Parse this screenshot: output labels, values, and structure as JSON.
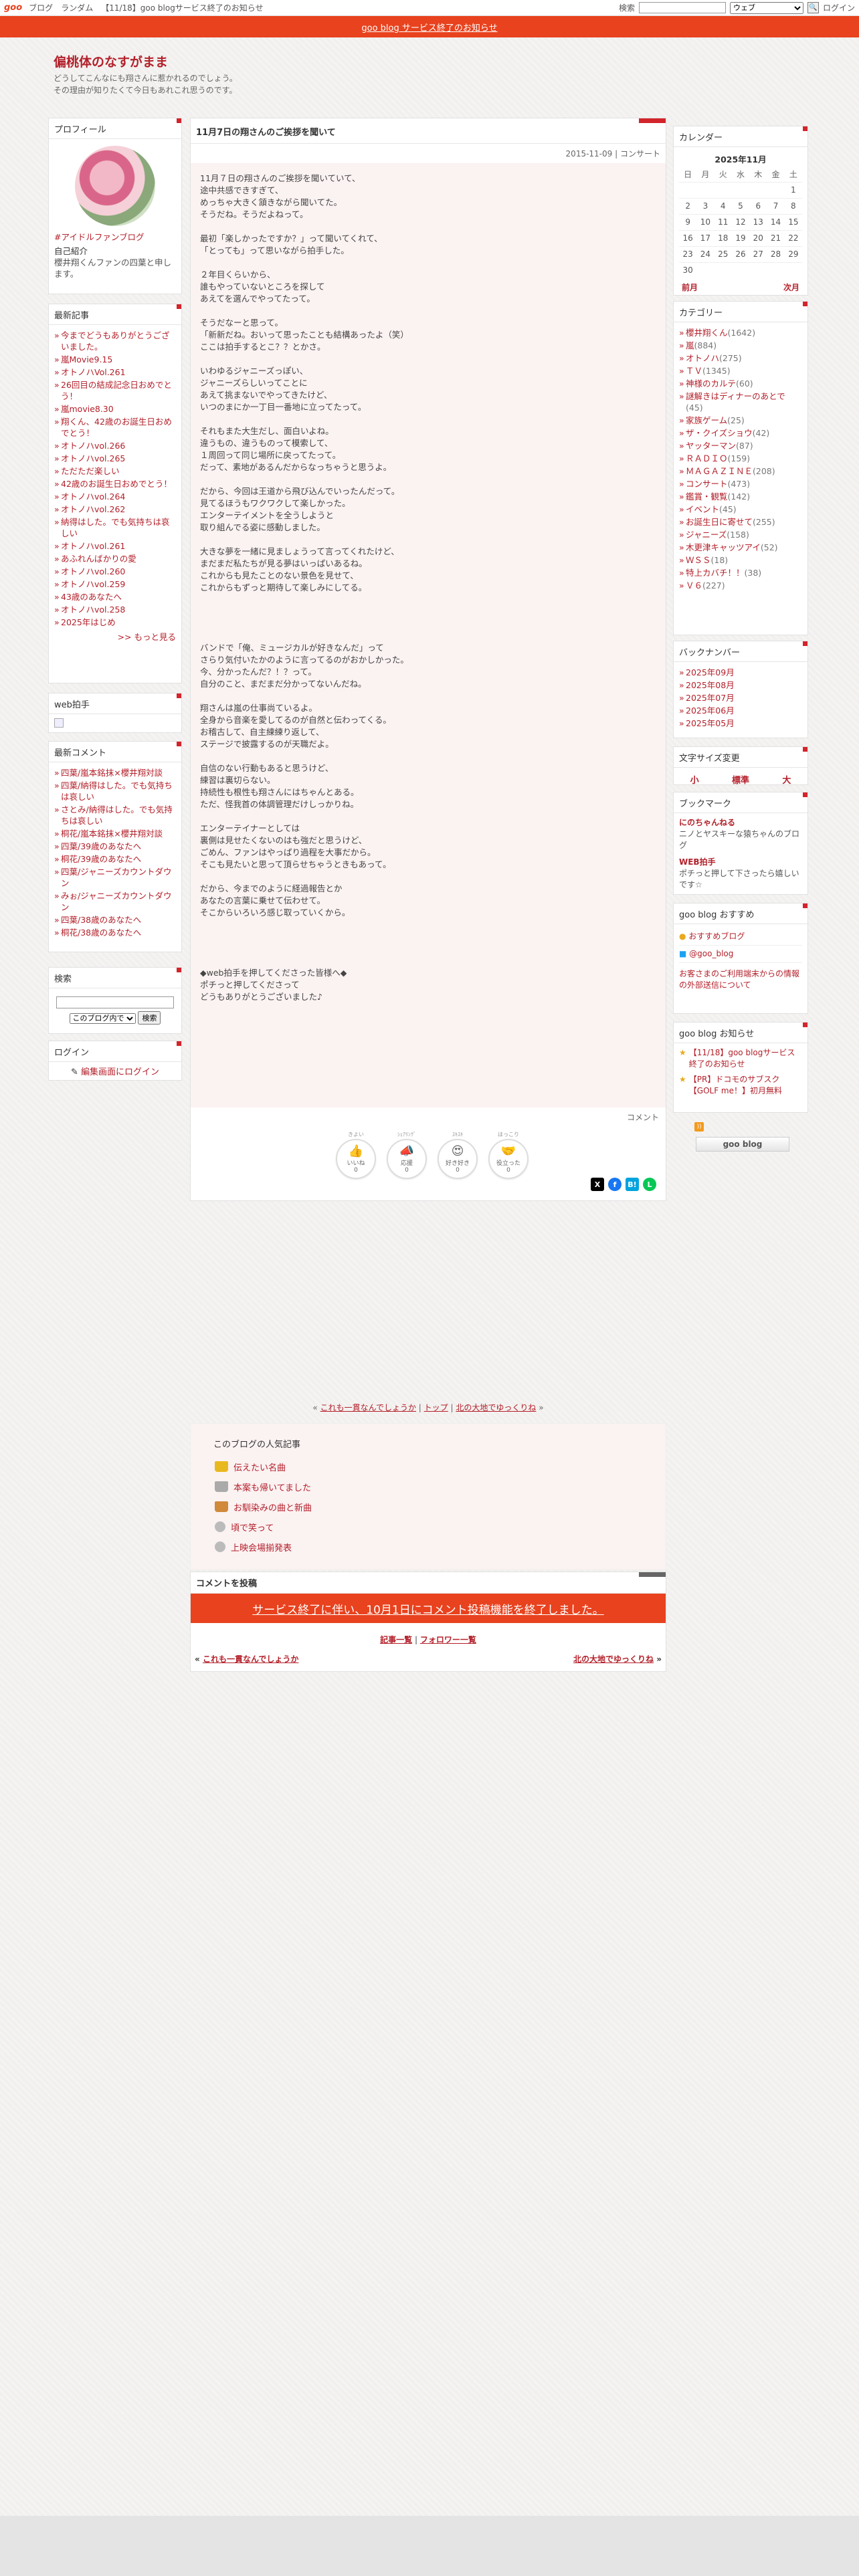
{
  "topbar": {
    "logo": "goo",
    "links": [
      "ブログ",
      "ランダム",
      "【11/18】goo blogサービス終了のお知らせ"
    ],
    "search_label": "検索",
    "search_scope": "ウェブ",
    "login": "ログイン"
  },
  "notice": "goo blog サービス終了のお知らせ",
  "blog": {
    "title": "偏桃体のなすがまま",
    "desc_line1": "どうしてこんなにも翔さんに惹かれるのでしょう。",
    "desc_line2": "その理由が知りたくて今日もあれこれ思うのです。"
  },
  "profile": {
    "title": "プロフィール",
    "link": "#アイドルファンブログ",
    "intro_label": "自己紹介",
    "intro": "櫻井翔くんファンの四葉と申します。"
  },
  "recent_posts": {
    "title": "最新記事",
    "items": [
      "今までどうもありがとうございました。",
      "嵐Movie9.15",
      "オトノハVol.261",
      "26回目の結成記念日おめでとう！",
      "嵐movie8.30",
      "翔くん、42歳のお誕生日おめでとう！",
      "オトノハvol.266",
      "オトノハvol.265",
      "ただただ楽しい",
      "42歳のお誕生日おめでとう！",
      "オトノハvol.264",
      "オトノハvol.262",
      "納得はした。でも気持ちは哀しい",
      "オトノハvol.261",
      "あふれんばかりの愛",
      "オトノハvol.260",
      "オトノハvol.259",
      "43歳のあなたへ",
      "オトノハvol.258",
      "2025年はじめ"
    ],
    "more": ">> もっと見る"
  },
  "web_clap": {
    "title": "web拍手"
  },
  "recent_comments": {
    "title": "最新コメント",
    "items": [
      "四葉/嵐本銘抹×櫻井翔対談",
      "四葉/納得はした。でも気持ちは哀しい",
      "さとみ/納得はした。でも気持ちは哀しい",
      "桐花/嵐本銘抹×櫻井翔対談",
      "四葉/39歳のあなたへ",
      "桐花/39歳のあなたへ",
      "四葉/ジャニーズカウントダウン",
      "みぉ/ジャニーズカウントダウン",
      "四葉/38歳のあなたへ",
      "桐花/38歳のあなたへ"
    ]
  },
  "search_box": {
    "title": "検索",
    "scope": "このブログ内で",
    "button": "検索"
  },
  "login_box": {
    "title": "ログイン",
    "link": "編集画面にログイン"
  },
  "entry": {
    "title": "11月7日の翔さんのご挨拶を聞いて",
    "date": "2015-11-09",
    "category": "コンサート",
    "paragraphs": [
      "11月７日の翔さんのご挨拶を聞いていて、\n途中共感できすぎて、\nめっちゃ大きく頷きながら聞いてた。\nそうだね。そうだよねって。",
      "最初「楽しかったですか？」って聞いてくれて、\n「とっても」って思いながら拍手した。",
      "２年目くらいから、\n誰もやっていないところを探して\nあえてを選んでやってたって。",
      "そうだなーと思って。\n「新新だね。おいって思ったことも結構あったよ（笑）\nここは拍手するとこ？？とかさ。",
      "いわゆるジャニーズっぽい、\nジャニーズらしいってことに\nあえて挑まないでやってきたけど、\nいつのまにか一丁目一番地に立ってたって。",
      "それもまた大生だし、面白いよね。\n違うもの、違うものって模索して、\n１周回って同じ場所に戻ってたって。\nだって、素地があるんだからなっちゃうと思うよ。",
      "だから、今回は王道から飛び込んでいったんだって。\n見てるほうもワクワクして楽しかった。\nエンターテイメントを全うしようと\n取り組んでる姿に感動しました。",
      "大きな夢を一緒に見ましょうって言ってくれたけど、\nまだまだ私たちが見る夢はいっぱいあるね。\nこれからも見たことのない景色を見せて、\nこれからもずっと期待して楽しみにしてる。",
      "",
      "バンドで「俺、ミュージカルが好きなんだ」って\nさらり気付いたかのように言ってるのがおかしかった。\n今、分かったんだ？！？って。\n自分のこと、まだまだ分かってないんだね。",
      "翔さんは嵐の仕事尚ているよ。\n全身から音楽を愛してるのが自然と伝わってくる。\nお稽古して、自主練練り返して、\nステージで披露するのが天職だよ。",
      "自信のない行動もあると思うけど、\n練習は裏切らない。\n持続性も根性も翔さんにはちゃんとある。\nただ、怪我首の体調管理だけしっかりね。",
      "エンターテイナーとしては\n裏側は見せたくないのはも強だと思うけど、\nごめん、ファンはやっぱり過程を大事だから。\nそこも見たいと思って頂らせちゃうときもあって。",
      "だから、今までのように経過報告とか\nあなたの言葉に乗せて伝わせて。\nそこからいろいろ感じ取っていくから。",
      "",
      "◆web拍手を押してくださった皆様へ◆\nポチっと押してくださって\nどうもありがとうございました♪"
    ],
    "comment_label": "コメント"
  },
  "reactions": [
    {
      "top": "きよい",
      "label": "いいね",
      "count": "0"
    },
    {
      "top": "ｼｪｱﾘﾝｸﾞ",
      "label": "応援",
      "count": "0"
    },
    {
      "top": "ｽｷｽｷ",
      "label": "好き好き",
      "count": "0"
    },
    {
      "top": "ほっこり",
      "label": "役立った",
      "count": "0"
    }
  ],
  "post_nav": {
    "prev": "これも一貫なんでしょうか",
    "top": "トップ",
    "next": "北の大地でゆっくりね",
    "sep": "|"
  },
  "popular": {
    "title": "このブログの人気記事",
    "items": [
      "伝えたい名曲",
      "本案も帰いてました",
      "お馴染みの曲と新曲",
      "頃で笑って",
      "上映会場揃発表"
    ]
  },
  "post_comment": {
    "title": "コメントを投稿",
    "banner": "サービス終了に伴い、10月1日にコメント投稿機能を終了しました。",
    "list_link": "記事一覧",
    "follower_link": "フォロワー一覧",
    "prev": "これも一貫なんでしょうか",
    "next": "北の大地でゆっくりね"
  },
  "calendar": {
    "title": "カレンダー",
    "month": "2025年11月",
    "weekdays": [
      "日",
      "月",
      "火",
      "水",
      "木",
      "金",
      "土"
    ],
    "weeks": [
      [
        "",
        "",
        "",
        "",
        "",
        "",
        "1"
      ],
      [
        "2",
        "3",
        "4",
        "5",
        "6",
        "7",
        "8"
      ],
      [
        "9",
        "10",
        "11",
        "12",
        "13",
        "14",
        "15"
      ],
      [
        "16",
        "17",
        "18",
        "19",
        "20",
        "21",
        "22"
      ],
      [
        "23",
        "24",
        "25",
        "26",
        "27",
        "28",
        "29"
      ],
      [
        "30",
        "",
        "",
        "",
        "",
        "",
        ""
      ]
    ],
    "prev": "前月",
    "next": "次月"
  },
  "categories": {
    "title": "カテゴリー",
    "items": [
      {
        "name": "櫻井翔くん",
        "count": "(1642)"
      },
      {
        "name": "嵐",
        "count": "(884)"
      },
      {
        "name": "オトノハ",
        "count": "(275)"
      },
      {
        "name": "ＴＶ",
        "count": "(1345)"
      },
      {
        "name": "神様のカルテ",
        "count": "(60)"
      },
      {
        "name": "謎解きはディナーのあとで",
        "count": "(45)"
      },
      {
        "name": "家族ゲーム",
        "count": "(25)"
      },
      {
        "name": "ザ・クイズショウ",
        "count": "(42)"
      },
      {
        "name": "ヤッターマン",
        "count": "(87)"
      },
      {
        "name": "ＲＡＤＩＯ",
        "count": "(159)"
      },
      {
        "name": "ＭＡＧＡＺＩＮＥ",
        "count": "(208)"
      },
      {
        "name": "コンサート",
        "count": "(473)"
      },
      {
        "name": "鑑賞・観覧",
        "count": "(142)"
      },
      {
        "name": "イベント",
        "count": "(45)"
      },
      {
        "name": "お誕生日に寄せて",
        "count": "(255)"
      },
      {
        "name": "ジャニーズ",
        "count": "(158)"
      },
      {
        "name": "木更津キャッツアイ",
        "count": "(52)"
      },
      {
        "name": "ＷＳＳ",
        "count": "(18)"
      },
      {
        "name": "特上カバチ！！",
        "count": "(38)"
      },
      {
        "name": "Ｖ６",
        "count": "(227)"
      }
    ]
  },
  "backnumber": {
    "title": "バックナンバー",
    "items": [
      "2025年09月",
      "2025年08月",
      "2025年07月",
      "2025年06月",
      "2025年05月"
    ]
  },
  "fontsize": {
    "title": "文字サイズ変更",
    "small": "小",
    "medium": "標準",
    "large": "大"
  },
  "bookmarks": {
    "title": "ブックマーク",
    "items": [
      {
        "name": "にのちゃんねる",
        "desc": "ニノとヤスキーな猿ちゃんのブログ"
      },
      {
        "name": "WEB拍手",
        "desc": "ポチっと押して下さったら嬉しいです☆"
      }
    ]
  },
  "goo_recommend": {
    "title": "goo blog おすすめ",
    "link1": "おすすめブログ",
    "link2": "@goo_blog",
    "text": "お客さまのご利用端末からの情報の外部送信について"
  },
  "goo_notice": {
    "title": "goo blog お知らせ",
    "items": [
      "【11/18】goo blogサービス終了のお知らせ",
      "【PR】ドコモのサブスク【GOLF me！】初月無料"
    ]
  },
  "logo_text": "goo blog",
  "colors": {
    "accent": "#e8421e",
    "link": "#b3202a",
    "corner": "#d3242c"
  }
}
